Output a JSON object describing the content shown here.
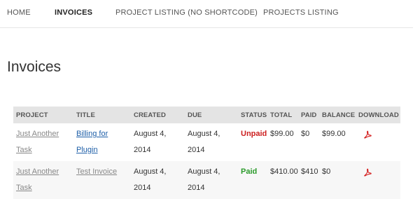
{
  "nav": {
    "items": [
      {
        "label": "HOME",
        "active": false
      },
      {
        "label": "INVOICES",
        "active": true
      },
      {
        "label": "PROJECT LISTING (NO SHORTCODE)",
        "active": false
      },
      {
        "label": "PROJECTS LISTING",
        "active": false
      }
    ]
  },
  "page": {
    "title": "Invoices"
  },
  "table": {
    "headers": [
      "PROJECT",
      "TITLE",
      "CREATED",
      "DUE",
      "STATUS",
      "TOTAL",
      "PAID",
      "BALANCE",
      "DOWNLOAD"
    ],
    "rows": [
      {
        "project": "Just Another Task",
        "title": "Billing for Plugin",
        "created": "August 4, 2014",
        "due": "August 4, 2014",
        "status": "Unpaid",
        "total": "$99.00",
        "paid": "$0",
        "balance": "$99.00",
        "download_icon": "pdf-icon"
      },
      {
        "project": "Just Another Task",
        "title": "Test Invoice",
        "created": "August 4, 2014",
        "due": "August 4, 2014",
        "status": "Paid",
        "total": "$410.00",
        "paid": "$410",
        "balance": "$0",
        "download_icon": "pdf-icon"
      }
    ]
  },
  "colors": {
    "unpaid": "#cc1e1e",
    "paid": "#2a9a2a",
    "link": "#1e5fa8",
    "header_bg": "#e4e4e4",
    "pdf_red": "#d42020"
  }
}
